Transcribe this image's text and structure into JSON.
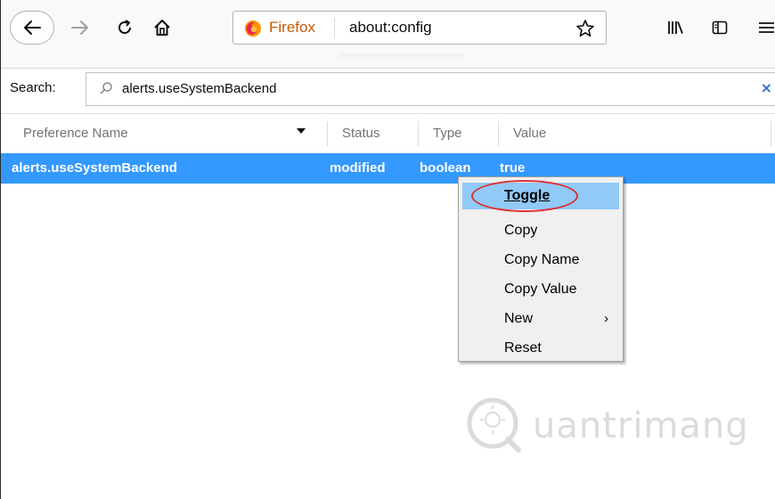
{
  "toolbar": {
    "identity_label": "Firefox",
    "url": "about:config"
  },
  "search": {
    "label": "Search:",
    "value": "alerts.useSystemBackend",
    "clear_glyph": "×"
  },
  "table": {
    "columns": [
      {
        "label": "Preference Name"
      },
      {
        "label": "Status"
      },
      {
        "label": "Type"
      },
      {
        "label": "Value"
      }
    ],
    "rows": [
      {
        "name": "alerts.useSystemBackend",
        "status": "modified",
        "type": "boolean",
        "value": "true"
      }
    ]
  },
  "context_menu": {
    "items": [
      {
        "label": "Toggle",
        "highlighted": true
      },
      {
        "label": "Copy"
      },
      {
        "label": "Copy Name"
      },
      {
        "label": "Copy Value"
      },
      {
        "label": "New",
        "submenu": true
      },
      {
        "label": "Reset"
      }
    ],
    "submenu_arrow": "›"
  },
  "watermark": {
    "text": "uantrimang"
  },
  "colors": {
    "selected_row": "#3399ff",
    "menu_highlight": "#91c9f7",
    "annotation_ellipse": "#e03030",
    "firefox_label": "#c55a00"
  },
  "icons": [
    "back-arrow-icon",
    "forward-arrow-icon",
    "reload-icon",
    "home-icon",
    "firefox-logo-icon",
    "bookmark-star-icon",
    "library-icon",
    "sidebar-icon",
    "hamburger-menu-icon",
    "search-icon",
    "sort-descending-icon",
    "chevron-right-icon"
  ]
}
